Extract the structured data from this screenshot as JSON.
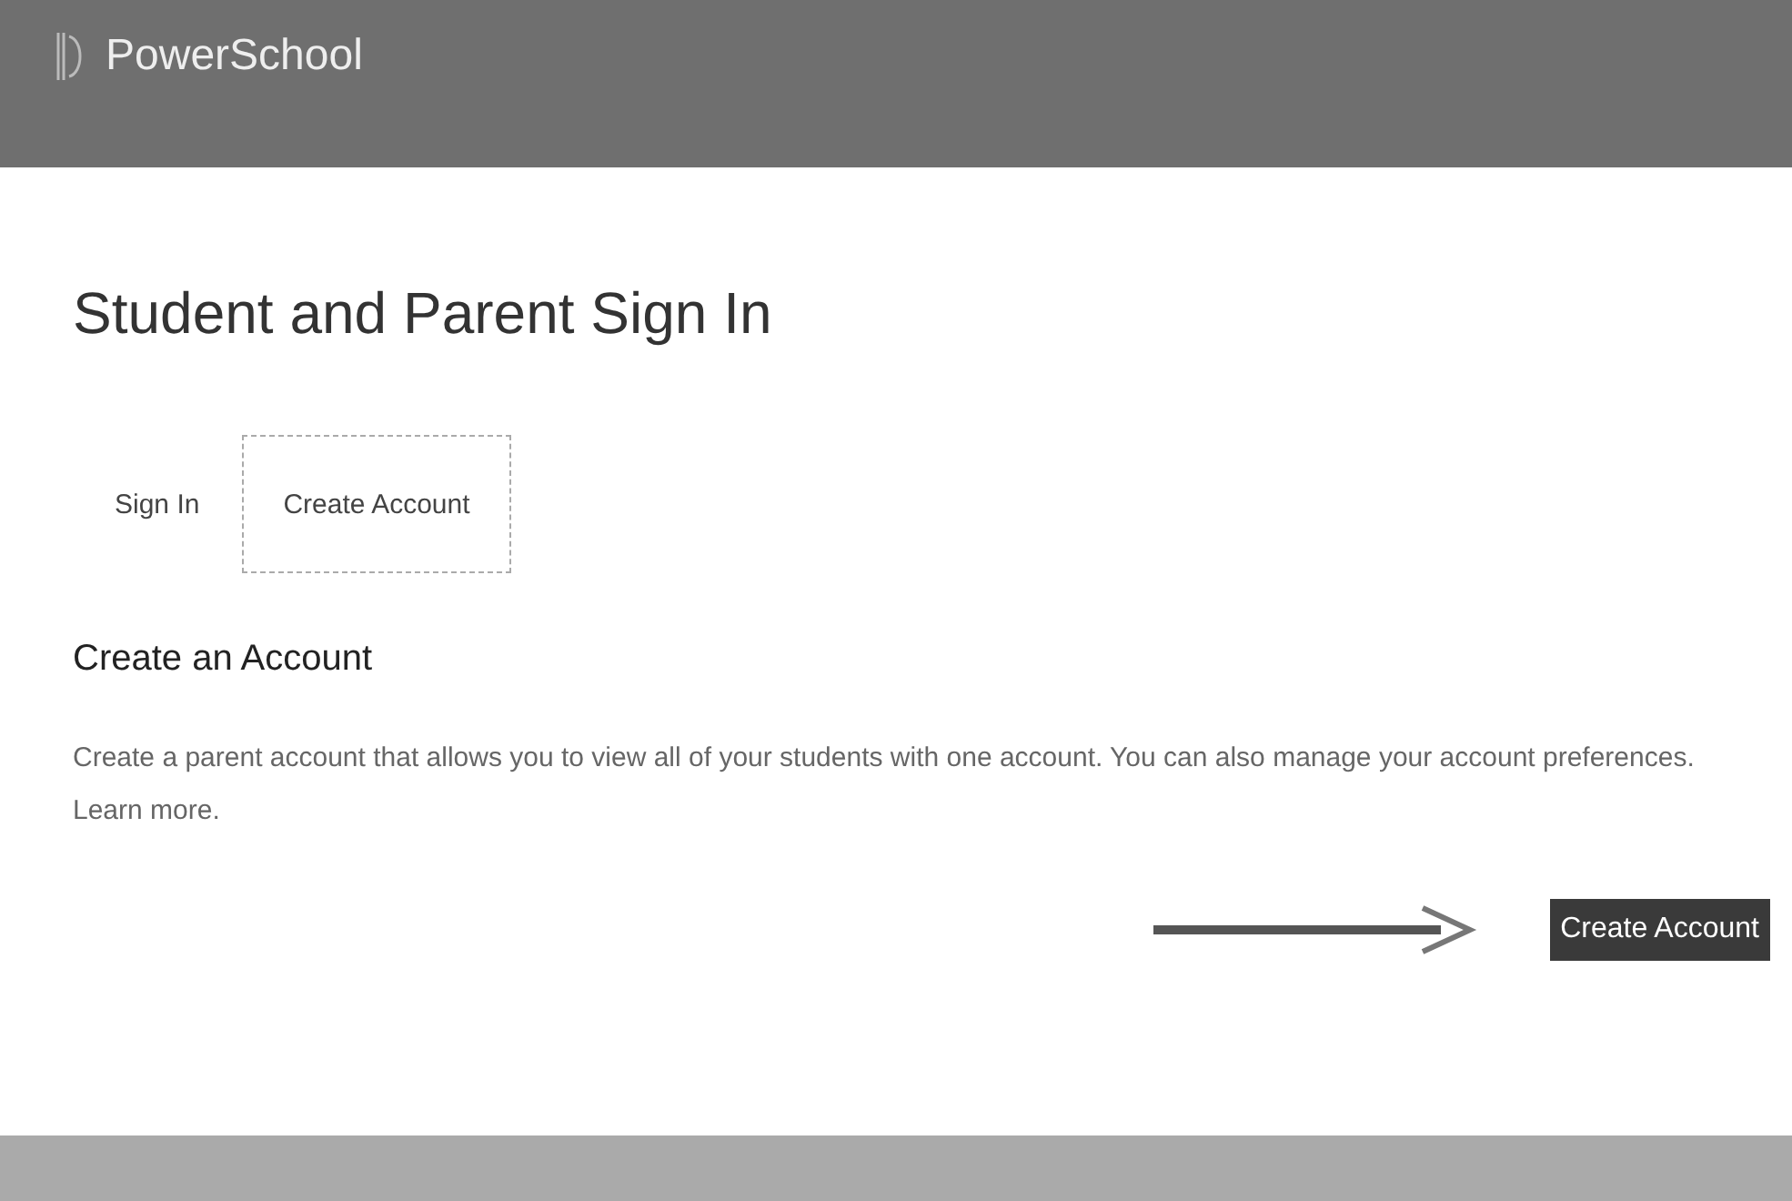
{
  "header": {
    "brand": "PowerSchool"
  },
  "title": "Student and Parent Sign In",
  "tabs": [
    {
      "label": "Sign In",
      "selected": false
    },
    {
      "label": "Create Account",
      "selected": true
    }
  ],
  "section": {
    "heading": "Create an Account",
    "text": "Create a parent account that allows you to view all of your students with one account. You can also manage your account preferences.",
    "link": "Learn more."
  },
  "button": "Create Account"
}
